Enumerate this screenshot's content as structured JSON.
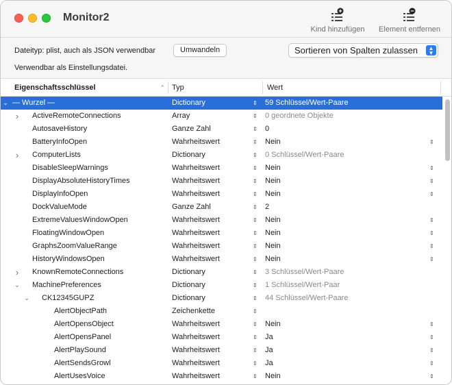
{
  "window": {
    "title": "Monitor2"
  },
  "toolbar": {
    "add_child_label": "Kind hinzufügen",
    "remove_item_label": "Element entfernen"
  },
  "options": {
    "filetype_label": "Dateityp: plist, auch als JSON verwendbar",
    "convert_button": "Umwandeln",
    "sort_select_value": "Sortieren von Spalten zulassen",
    "usable_note": "Verwendbar als Einstellungsdatei."
  },
  "table": {
    "headers": {
      "key": "Eigenschaftsschlüssel",
      "type": "Typ",
      "value": "Wert"
    },
    "rows": [
      {
        "key": "— Wurzel —",
        "type": "Dictionary",
        "value": "59 Schlüssel/Wert-Paare",
        "level": 0,
        "disclosure": "expanded",
        "selected": true,
        "muted": false,
        "value_stepper": false
      },
      {
        "key": "ActiveRemoteConnections",
        "type": "Array",
        "value": "0 geordnete Objekte",
        "level": 1,
        "disclosure": "collapsed",
        "selected": false,
        "muted": true,
        "value_stepper": false
      },
      {
        "key": "AutosaveHistory",
        "type": "Ganze Zahl",
        "value": "0",
        "level": 1,
        "disclosure": "none",
        "selected": false,
        "muted": false,
        "value_stepper": false
      },
      {
        "key": "BatteryInfoOpen",
        "type": "Wahrheitswert",
        "value": "Nein",
        "level": 1,
        "disclosure": "none",
        "selected": false,
        "muted": false,
        "value_stepper": true
      },
      {
        "key": "ComputerLists",
        "type": "Dictionary",
        "value": "0 Schlüssel/Wert-Paare",
        "level": 1,
        "disclosure": "collapsed",
        "selected": false,
        "muted": true,
        "value_stepper": false
      },
      {
        "key": "DisableSleepWarnings",
        "type": "Wahrheitswert",
        "value": "Nein",
        "level": 1,
        "disclosure": "none",
        "selected": false,
        "muted": false,
        "value_stepper": true
      },
      {
        "key": "DisplayAbsoluteHistoryTimes",
        "type": "Wahrheitswert",
        "value": "Nein",
        "level": 1,
        "disclosure": "none",
        "selected": false,
        "muted": false,
        "value_stepper": true
      },
      {
        "key": "DisplayInfoOpen",
        "type": "Wahrheitswert",
        "value": "Nein",
        "level": 1,
        "disclosure": "none",
        "selected": false,
        "muted": false,
        "value_stepper": true
      },
      {
        "key": "DockValueMode",
        "type": "Ganze Zahl",
        "value": "2",
        "level": 1,
        "disclosure": "none",
        "selected": false,
        "muted": false,
        "value_stepper": false
      },
      {
        "key": "ExtremeValuesWindowOpen",
        "type": "Wahrheitswert",
        "value": "Nein",
        "level": 1,
        "disclosure": "none",
        "selected": false,
        "muted": false,
        "value_stepper": true
      },
      {
        "key": "FloatingWindowOpen",
        "type": "Wahrheitswert",
        "value": "Nein",
        "level": 1,
        "disclosure": "none",
        "selected": false,
        "muted": false,
        "value_stepper": true
      },
      {
        "key": "GraphsZoomValueRange",
        "type": "Wahrheitswert",
        "value": "Nein",
        "level": 1,
        "disclosure": "none",
        "selected": false,
        "muted": false,
        "value_stepper": true
      },
      {
        "key": "HistoryWindowsOpen",
        "type": "Wahrheitswert",
        "value": "Nein",
        "level": 1,
        "disclosure": "none",
        "selected": false,
        "muted": false,
        "value_stepper": true
      },
      {
        "key": "KnownRemoteConnections",
        "type": "Dictionary",
        "value": "3 Schlüssel/Wert-Paare",
        "level": 1,
        "disclosure": "collapsed",
        "selected": false,
        "muted": true,
        "value_stepper": false
      },
      {
        "key": "MachinePreferences",
        "type": "Dictionary",
        "value": "1 Schlüssel/Wert-Paar",
        "level": 1,
        "disclosure": "expanded",
        "selected": false,
        "muted": true,
        "value_stepper": false
      },
      {
        "key": "CK12345GUPZ",
        "type": "Dictionary",
        "value": "44 Schlüssel/Wert-Paare",
        "level": 2,
        "disclosure": "expanded",
        "selected": false,
        "muted": true,
        "value_stepper": false
      },
      {
        "key": "AlertObjectPath",
        "type": "Zeichenkette",
        "value": "",
        "level": 3,
        "disclosure": "none",
        "selected": false,
        "muted": false,
        "value_stepper": false
      },
      {
        "key": "AlertOpensObject",
        "type": "Wahrheitswert",
        "value": "Nein",
        "level": 3,
        "disclosure": "none",
        "selected": false,
        "muted": false,
        "value_stepper": true
      },
      {
        "key": "AlertOpensPanel",
        "type": "Wahrheitswert",
        "value": "Ja",
        "level": 3,
        "disclosure": "none",
        "selected": false,
        "muted": false,
        "value_stepper": true
      },
      {
        "key": "AlertPlaySound",
        "type": "Wahrheitswert",
        "value": "Ja",
        "level": 3,
        "disclosure": "none",
        "selected": false,
        "muted": false,
        "value_stepper": true
      },
      {
        "key": "AlertSendsGrowl",
        "type": "Wahrheitswert",
        "value": "Ja",
        "level": 3,
        "disclosure": "none",
        "selected": false,
        "muted": false,
        "value_stepper": true
      },
      {
        "key": "AlertUsesVoice",
        "type": "Wahrheitswert",
        "value": "Nein",
        "level": 3,
        "disclosure": "none",
        "selected": false,
        "muted": false,
        "value_stepper": true
      }
    ]
  },
  "colors": {
    "selection": "#2a6fd8",
    "close": "#fe5f57",
    "minimize": "#febc2e",
    "zoom": "#28c840",
    "accent": "#2a7cf0"
  },
  "icons": {
    "add_child": "list-plus-icon",
    "remove_item": "list-minus-icon",
    "expanded": "chevron-down-icon",
    "collapsed": "chevron-right-icon",
    "stepper": "up-down-stepper-icon"
  }
}
